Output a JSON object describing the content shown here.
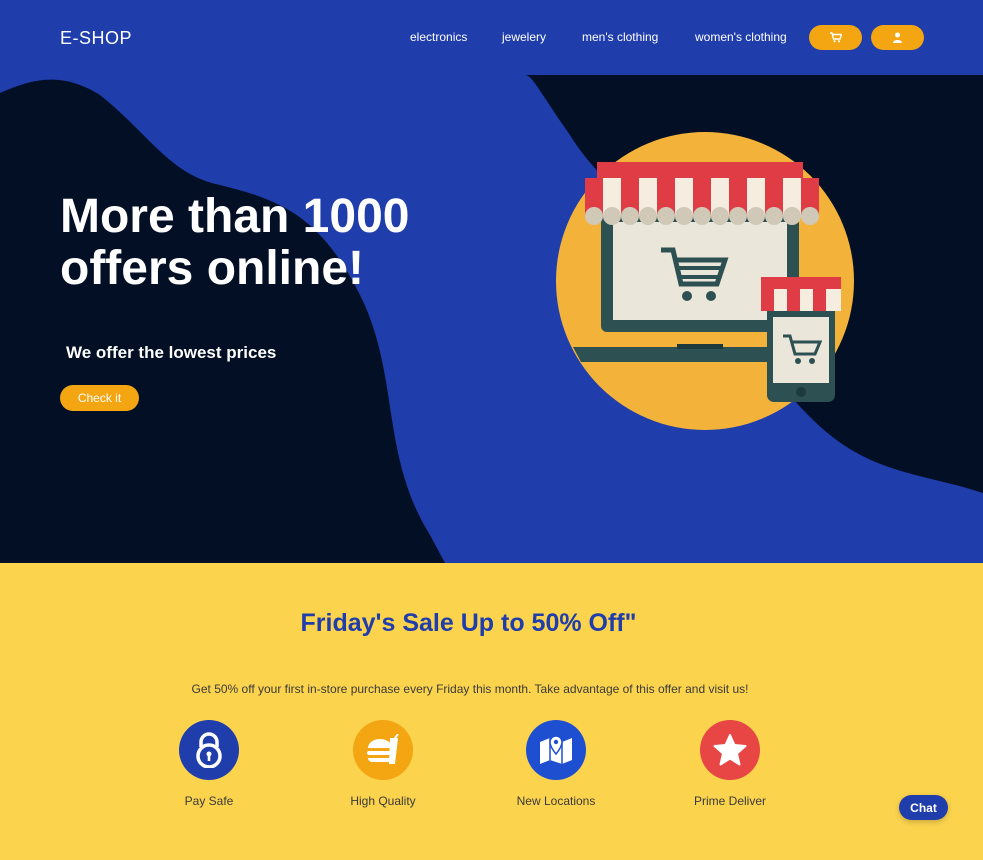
{
  "navbar": {
    "brand": "E-SHOP",
    "links": [
      "electronics",
      "jewelery",
      "men's clothing",
      "women's clothing"
    ],
    "cart_icon": "cart-icon",
    "user_icon": "user-icon"
  },
  "hero": {
    "title": "More than 1000 offers online!",
    "subtitle": "We offer the lowest prices",
    "cta_label": "Check it"
  },
  "sale": {
    "title": "Friday's Sale Up to 50% Off\"",
    "text": "Get 50% off your first in-store purchase every Friday this month. Take advantage of this offer and visit us!",
    "features": [
      {
        "label": "Pay Safe",
        "icon": "lock-icon",
        "color": "#1f3dab"
      },
      {
        "label": "High Quality",
        "icon": "burger-icon",
        "color": "#f3a512"
      },
      {
        "label": "New Locations",
        "icon": "map-icon",
        "color": "#1f4fd1"
      },
      {
        "label": "Prime Deliver",
        "icon": "star-icon",
        "color": "#e84545"
      }
    ]
  },
  "chat": {
    "label": "Chat"
  },
  "colors": {
    "navy": "#1f3dab",
    "dark": "#030f24",
    "accent": "#f3a512",
    "yellow": "#fbd34d",
    "red": "#e84545"
  }
}
